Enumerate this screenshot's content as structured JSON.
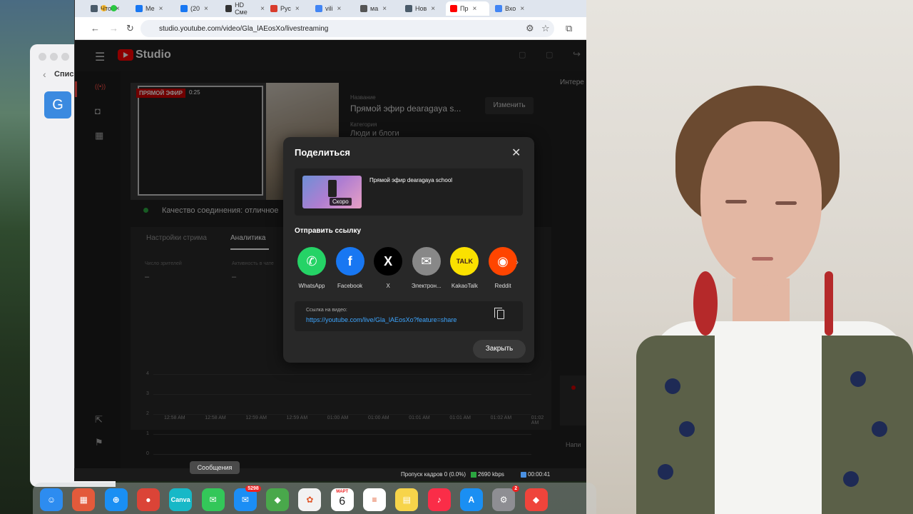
{
  "browser": {
    "tabs": [
      {
        "label": "Что",
        "color": "#4a5b6a"
      },
      {
        "label": "Ме",
        "color": "#1877f2"
      },
      {
        "label": "(20",
        "color": "#1877f2"
      },
      {
        "label": "HD Сме",
        "color": "#333333"
      },
      {
        "label": "Рус",
        "color": "#d83b2c"
      },
      {
        "label": "vili",
        "color": "#4285f4"
      },
      {
        "label": "ма",
        "color": "#555555"
      },
      {
        "label": "Нов",
        "color": "#4a5b6a"
      },
      {
        "label": "Пр",
        "color": "#ff0000"
      },
      {
        "label": "Вхо",
        "color": "#4285f4"
      }
    ],
    "url": "studio.youtube.com/video/Gla_lAEosXo/livestreaming"
  },
  "finder": {
    "back_glyph": "‹",
    "title": "Списо",
    "tile": "G"
  },
  "studio": {
    "logo_text": "Studio",
    "live_badge": "ПРЯМОЙ ЭФИР",
    "live_time": "0:25",
    "title_label": "Название",
    "title_value": "Прямой эфир dearagaya s...",
    "category_label": "Категория",
    "category_value": "Люди и блоги",
    "edit_button": "Изменить",
    "right_panel_label": "Интере",
    "connection_quality": "Качество соединения: отличное",
    "tabs": [
      "Настройки стрима",
      "Аналитика"
    ],
    "metrics": [
      {
        "label": "Число зрителей",
        "value": "–"
      },
      {
        "label": "Активность в чате",
        "value": "–"
      }
    ],
    "chart_yticks": [
      "4",
      "3",
      "2",
      "1",
      "0"
    ],
    "chart_xticks": [
      "12:58 AM",
      "12:58 AM",
      "12:59 AM",
      "12:59 AM",
      "01:00 AM",
      "01:00 AM",
      "01:01 AM",
      "01:01 AM",
      "01:02 AM",
      "01:02 AM"
    ],
    "write_label": "Напи"
  },
  "share_dialog": {
    "title": "Поделиться",
    "video_title": "Прямой эфир dearagaya school",
    "thumb_badge": "Скоро",
    "send_label": "Отправить ссылку",
    "targets": [
      {
        "label": "WhatsApp",
        "glyph": "✆",
        "color": "#25d366",
        "text_color": "#ffffff"
      },
      {
        "label": "Facebook",
        "glyph": "f",
        "color": "#1877f2",
        "text_color": "#ffffff"
      },
      {
        "label": "X",
        "glyph": "X",
        "color": "#000000",
        "text_color": "#ffffff"
      },
      {
        "label": "Электрон...",
        "glyph": "✉",
        "color": "#888888",
        "text_color": "#ffffff"
      },
      {
        "label": "KakaoTalk",
        "glyph": "TALK",
        "color": "#fae100",
        "text_color": "#3c1e1e"
      },
      {
        "label": "Reddit",
        "glyph": "◉",
        "color": "#ff4500",
        "text_color": "#ffffff"
      }
    ],
    "link_label": "Ссылка на видео:",
    "link_value": "https://youtube.com/live/Gla_lAEosXo?feature=share",
    "close_button": "Закрыть"
  },
  "statusbar": {
    "dropped_frames": "Пропуск кадров 0 (0.0%)",
    "bitrate": "2690 kbps",
    "time": "00:00:41"
  },
  "tooltip": "Сообщения",
  "dock": {
    "apps": [
      {
        "name": "finder",
        "glyph": "☺",
        "color": "#2d8cf0"
      },
      {
        "name": "launchpad",
        "glyph": "▦",
        "color": "#e35a3b"
      },
      {
        "name": "safari",
        "glyph": "⊕",
        "color": "#1a8ff3"
      },
      {
        "name": "chrome",
        "glyph": "●",
        "color": "#db4437"
      },
      {
        "name": "canva",
        "glyph": "Canva",
        "color": "#17b8c7"
      },
      {
        "name": "messages",
        "glyph": "✉",
        "color": "#33c759"
      },
      {
        "name": "mail",
        "glyph": "✉",
        "color": "#1b8ef5"
      },
      {
        "name": "maps",
        "glyph": "◆",
        "color": "#49a84b"
      },
      {
        "name": "photos",
        "glyph": "✿",
        "color": "#f2f2f2"
      },
      {
        "name": "calendar",
        "glyph": "",
        "color": "#ffffff"
      },
      {
        "name": "reminders",
        "glyph": "≡",
        "color": "#ffffff"
      },
      {
        "name": "notes",
        "glyph": "▤",
        "color": "#f7d44a"
      },
      {
        "name": "music",
        "glyph": "♪",
        "color": "#fa2d48"
      },
      {
        "name": "appstore",
        "glyph": "A",
        "color": "#1a8ff3"
      },
      {
        "name": "settings",
        "glyph": "⚙",
        "color": "#8e8e93"
      },
      {
        "name": "anydesk",
        "glyph": "◆",
        "color": "#ef443b"
      }
    ],
    "mail_badge": "5298",
    "settings_badge": "2",
    "calendar_month": "МАРТ",
    "calendar_day": "6"
  }
}
